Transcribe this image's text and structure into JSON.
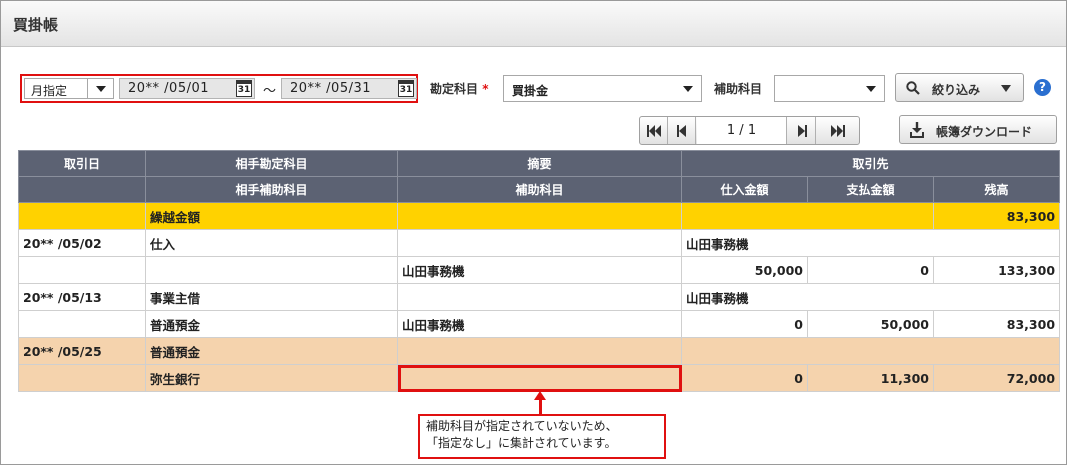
{
  "page": {
    "title": "買掛帳"
  },
  "filter": {
    "period_mode": "月指定",
    "date_from": "20** /05/01",
    "date_to": "20** /05/31",
    "range_sep": "〜",
    "calendar_glyph": "31",
    "account_label": "勘定科目",
    "required_mark": "*",
    "account_value": "買掛金",
    "sub_account_label": "補助科目",
    "sub_account_value": "",
    "narrow_button": "絞り込み",
    "help": "?"
  },
  "pager": {
    "first": "⏮",
    "prev": "⏴",
    "page": "1 / 1",
    "next": "⏵",
    "last": "⏭"
  },
  "download_button": "帳簿ダウンロード",
  "table": {
    "head1": [
      "取引日",
      "相手勘定科目",
      "摘要",
      "取引先"
    ],
    "head2": [
      "",
      "相手補助科目",
      "補助科目",
      "仕入金額",
      "支払金額",
      "残高"
    ],
    "carry_label": "繰越金額",
    "carry_balance": "83,300",
    "rows": [
      {
        "date": "20** /05/02",
        "account": "仕入",
        "summary": "",
        "partner": "山田事務機",
        "sub_account": "",
        "sub": "山田事務機",
        "purchase": "50,000",
        "payment": "0",
        "balance": "133,300"
      },
      {
        "date": "20** /05/13",
        "account": "事業主借",
        "summary": "",
        "partner": "山田事務機",
        "sub_account": "普通預金",
        "sub": "山田事務機",
        "purchase": "0",
        "payment": "50,000",
        "balance": "83,300"
      },
      {
        "date": "20** /05/25",
        "account": "普通預金",
        "summary": "",
        "partner": "",
        "sub_account": "弥生銀行",
        "sub": "",
        "purchase": "0",
        "payment": "11,300",
        "balance": "72,000"
      }
    ]
  },
  "callout": {
    "line1": "補助科目が指定されていないため、",
    "line2": "「指定なし」に集計されています。"
  },
  "colors": {
    "header": "#5c6273",
    "carry": "#ffd200",
    "highlight": "#f5d3ad",
    "annotation": "#e01010"
  },
  "icons": [
    "calendar-icon",
    "search-icon",
    "download-icon",
    "help-icon",
    "first-page-icon",
    "prev-page-icon",
    "next-page-icon",
    "last-page-icon"
  ]
}
